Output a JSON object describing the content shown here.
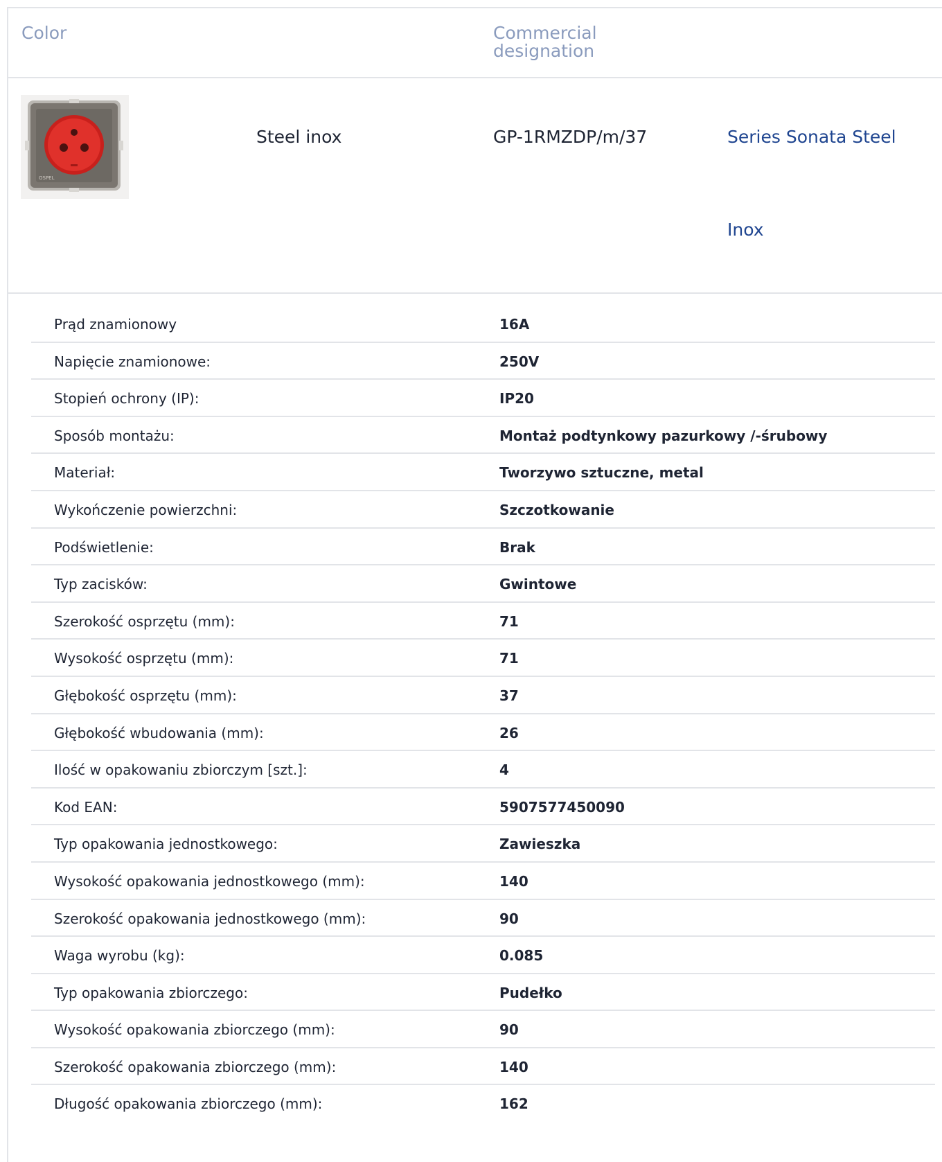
{
  "table_header": {
    "color": "Color",
    "commercial_designation": "Commercial\ndesignation"
  },
  "product": {
    "image_icon": "socket-outlet-red-icon",
    "color": "Steel inox",
    "designation": "GP-1RMZDP/m/37",
    "series_line1": "Series Sonata Steel",
    "series_line2": "Inox"
  },
  "specs": [
    {
      "label": "Prąd znamionowy",
      "value": "16A"
    },
    {
      "label": "Napięcie znamionowe:",
      "value": "250V"
    },
    {
      "label": "Stopień ochrony (IP):",
      "value": "IP20"
    },
    {
      "label": "Sposób montażu:",
      "value": "Montaż podtynkowy pazurkowy /-śrubowy"
    },
    {
      "label": "Materiał:",
      "value": "Tworzywo sztuczne, metal"
    },
    {
      "label": "Wykończenie powierzchni:",
      "value": "Szczotkowanie"
    },
    {
      "label": "Podświetlenie:",
      "value": "Brak"
    },
    {
      "label": "Typ zacisków:",
      "value": "Gwintowe"
    },
    {
      "label": "Szerokość osprzętu (mm):",
      "value": "71"
    },
    {
      "label": "Wysokość osprzętu (mm):",
      "value": "71"
    },
    {
      "label": "Głębokość osprzętu (mm):",
      "value": "37"
    },
    {
      "label": "Głębokość wbudowania (mm):",
      "value": "26"
    },
    {
      "label": "Ilość w opakowaniu zbiorczym [szt.]:",
      "value": "4"
    },
    {
      "label": "Kod EAN:",
      "value": "5907577450090"
    },
    {
      "label": "Typ opakowania jednostkowego:",
      "value": "Zawieszka"
    },
    {
      "label": "Wysokość opakowania jednostkowego (mm):",
      "value": "140"
    },
    {
      "label": "Szerokość opakowania jednostkowego (mm):",
      "value": "90"
    },
    {
      "label": "Waga wyrobu (kg):",
      "value": "0.085"
    },
    {
      "label": "Typ opakowania zbiorczego:",
      "value": "Pudełko"
    },
    {
      "label": "Wysokość opakowania zbiorczego (mm):",
      "value": "90"
    },
    {
      "label": "Szerokość opakowania zbiorczego (mm):",
      "value": "140"
    },
    {
      "label": "Długość opakowania zbiorczego (mm):",
      "value": "162"
    }
  ],
  "colors": {
    "header_text": "#8a9bbd",
    "link": "#1f4590",
    "text": "#1e2433",
    "divider": "#e2e4e8",
    "socket_red": "#e0312b",
    "frame_steel": "#7b7670"
  }
}
